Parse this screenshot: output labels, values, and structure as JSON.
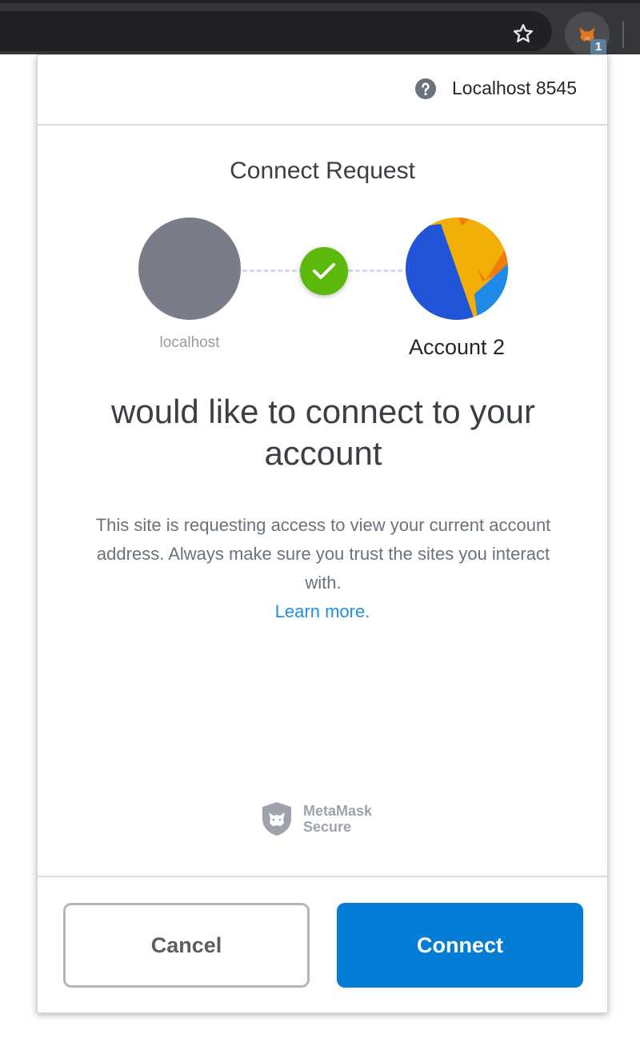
{
  "browser": {
    "extension_badge": "1"
  },
  "header": {
    "network_name": "Localhost 8545"
  },
  "request": {
    "title": "Connect Request",
    "site_label": "localhost",
    "account_label": "Account 2",
    "headline": "would like to connect to your account",
    "description": "This site is requesting access to view your current account address. Always make sure you trust the sites you interact with.",
    "learn_more": "Learn more."
  },
  "branding": {
    "secure_line1": "MetaMask",
    "secure_line2": "Secure"
  },
  "actions": {
    "cancel_label": "Cancel",
    "connect_label": "Connect"
  },
  "colors": {
    "primary": "#037dd6",
    "success": "#5cb80a",
    "link": "#1f8fe5",
    "site_avatar": "#787d89"
  },
  "icons": {
    "bookmark": "star-icon",
    "extension": "metamask-fox-icon",
    "help": "question-circle-icon",
    "check": "checkmark-icon",
    "secure": "shield-fox-icon"
  }
}
